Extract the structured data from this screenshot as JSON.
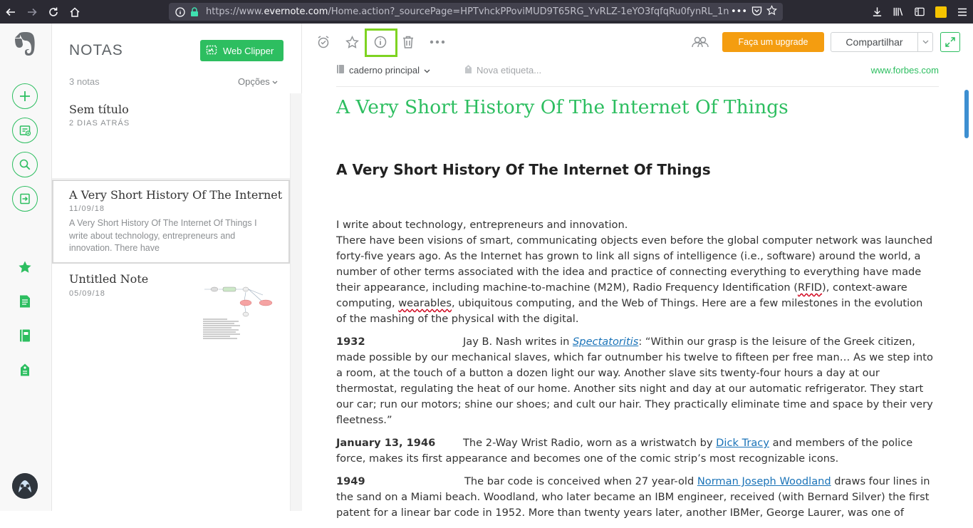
{
  "browser": {
    "url_prefix": "https://www.",
    "url_domain": "evernote.com",
    "url_path": "/Home.action?_sourcePage=HPTvhckPPoviMUD9T65RG_YvRLZ-1eYO3fqfqRu0fynRL_1n",
    "more_glyph": "•••"
  },
  "notes_panel": {
    "title": "NOTAS",
    "web_clipper": "Web Clipper",
    "count": "3 notas",
    "options": "Opções",
    "notes": [
      {
        "title": "Sem título",
        "date": "2 DIAS ATRÁS",
        "snippet": ""
      },
      {
        "title": "A Very Short History Of The Internet",
        "date": "11/09/18",
        "snippet": "A Very Short History Of The Internet Of Things I write about technology, entrepreneurs and innovation. There have"
      },
      {
        "title": "Untitled Note",
        "date": "05/09/18",
        "snippet": ""
      }
    ]
  },
  "editor": {
    "upgrade": "Faça um upgrade",
    "share": "Compartilhar",
    "notebook": "caderno principal",
    "tag_placeholder": "Nova etiqueta...",
    "source": "www.forbes.com",
    "note_title": "A Very Short History Of The Internet Of Things",
    "article_title": "A Very Short History Of The Internet Of Things",
    "intro_1": "I write about technology, entrepreneurs and innovation.",
    "intro_2a": "There have been visions of smart, communicating objects even before the global computer network was launched forty-five years ago. As the Internet has grown to link all signs of intelligence (i.e., software) around the world, a number of other terms associated with the idea and practice of connecting everything to everything have made their appearance, including machine-to-machine (M2M), Radio Frequency Identification (",
    "intro_2_rfid": "RFID",
    "intro_2b": "), context-aware computing, ",
    "intro_2_wearables": "wearables",
    "intro_2c": ", ubiquitous computing, and the Web of Things. Here are a few milestones in the evolution of the mashing of the physical with the digital.",
    "entries": [
      {
        "year": "1932",
        "pre": "Jay B. Nash writes in ",
        "link": "Spectatoritis",
        "post": ": “Within our grasp is the leisure of the Greek citizen, made possible by our mechanical slaves, which far outnumber his twelve to fifteen per free man… As we step into a room, at the touch of a button a dozen light our way. Another slave sits twenty-four hours a day at our thermostat, regulating the heat of our home. Another sits night and day at our automatic refrigerator. They start our car; run our motors; shine our shoes; and cult our hair. They practically eliminate time and space by their very fleetness.”"
      },
      {
        "year": "January 13, 1946",
        "pre": "The 2-Way Wrist Radio, worn as a wristwatch by ",
        "link": "Dick Tracy",
        "post": " and members of the police force, makes its first appearance and becomes one of the comic strip’s most recognizable icons."
      },
      {
        "year": "1949",
        "pre": "The bar code is conceived when 27 year-old ",
        "link": "Norman Joseph Woodland",
        "post": " draws four lines in the sand on a Miami beach. Woodland, who later became an IBM engineer, received (with Bernard Silver) the first patent for a linear bar code in 1952. More than twenty years later, another IBMer, George Laurer, was one of"
      }
    ]
  },
  "colors": {
    "accent": "#2dbe60",
    "upgrade": "#f49d10",
    "highlight": "#7ed321",
    "link": "#1a73b8"
  }
}
